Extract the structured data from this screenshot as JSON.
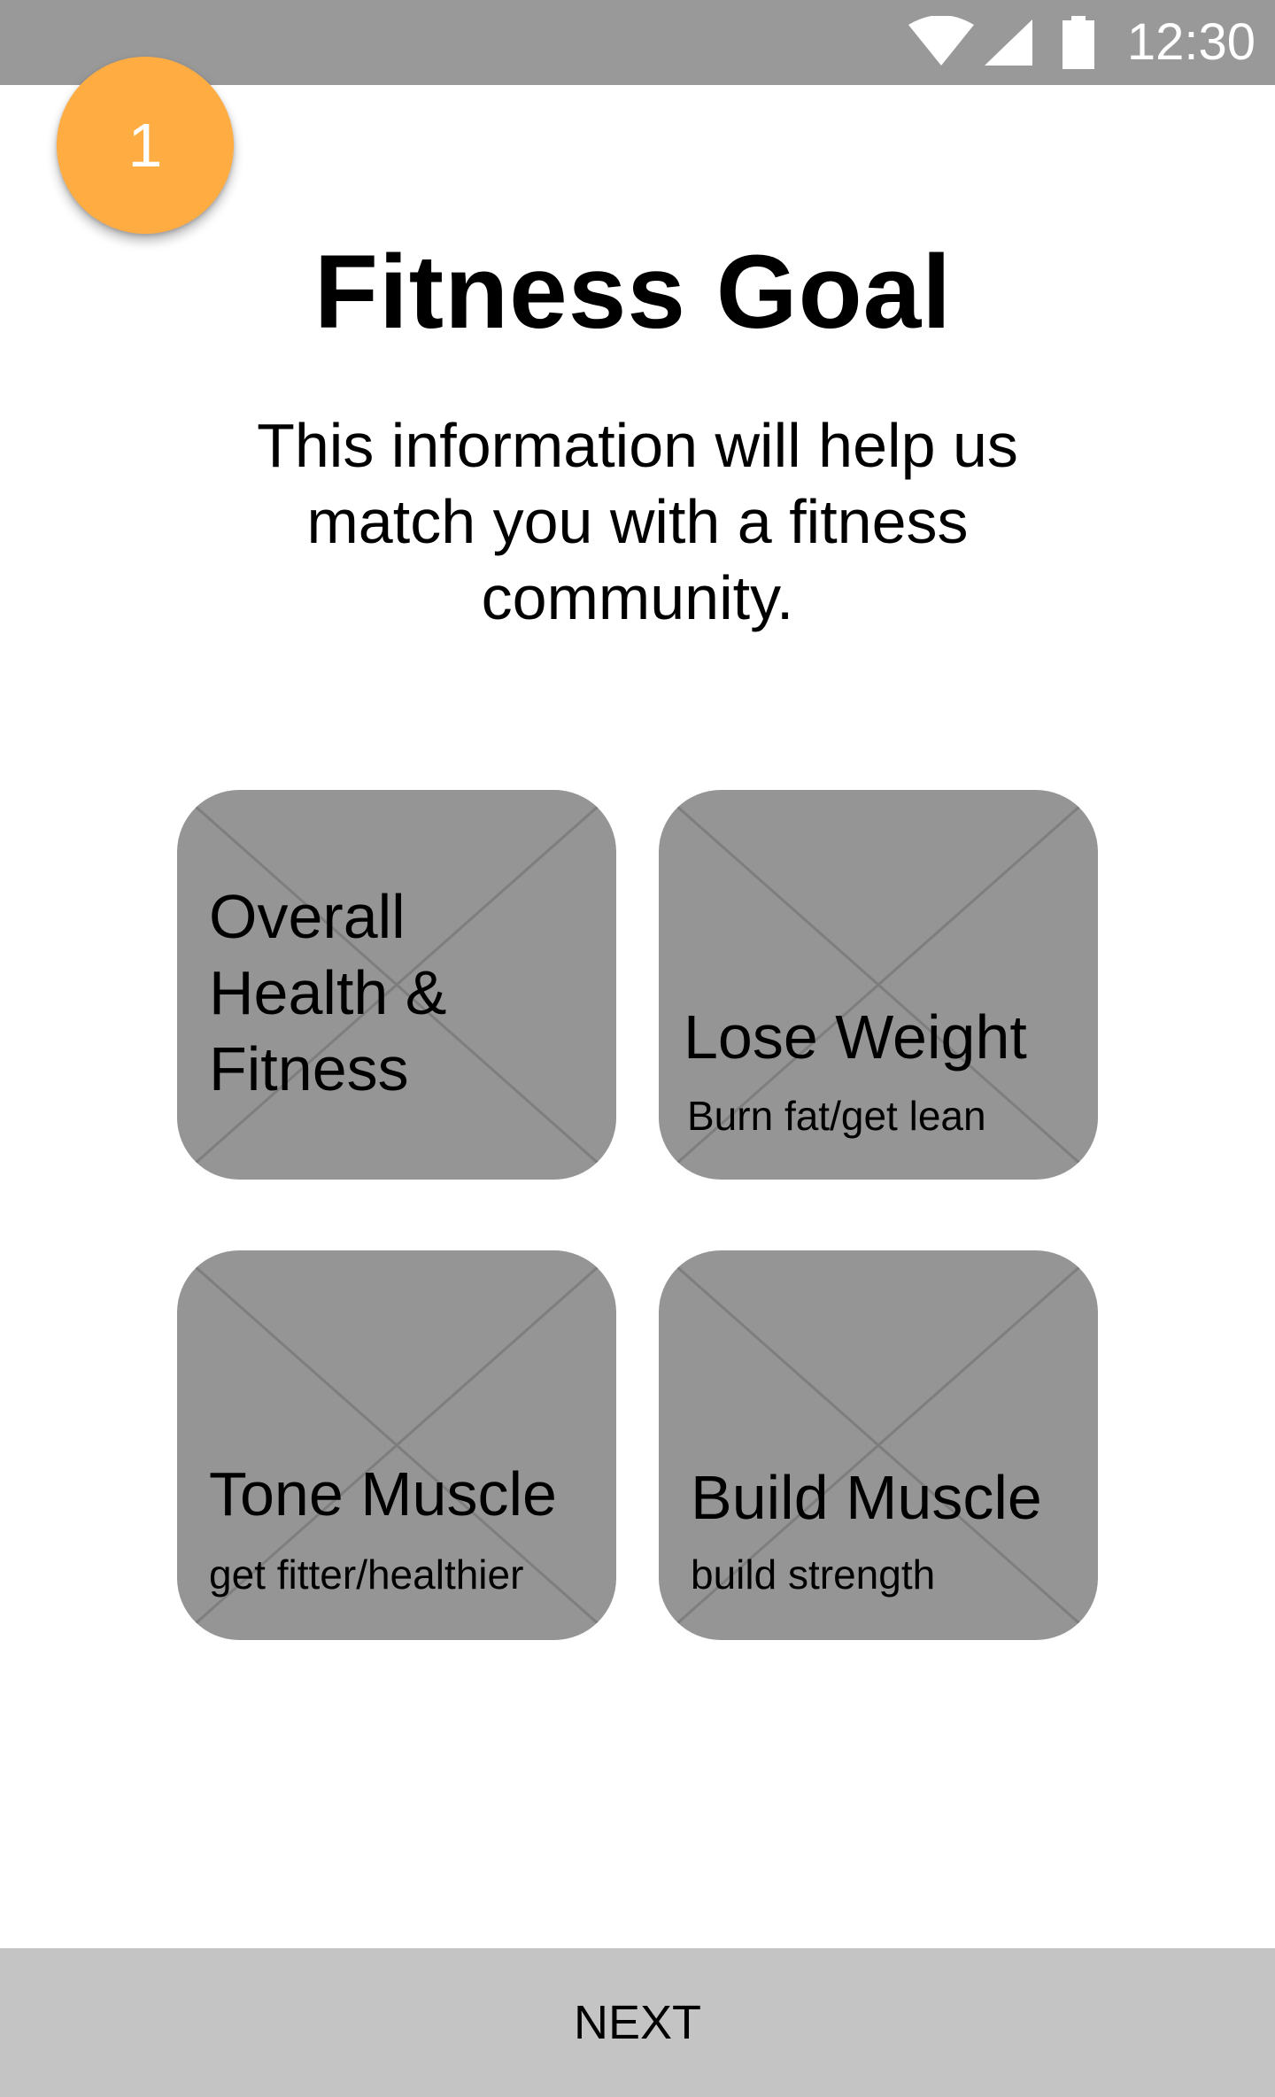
{
  "status_bar": {
    "time": "12:30",
    "icons": [
      "wifi-icon",
      "cellular-signal-icon",
      "battery-icon"
    ],
    "background": "#999999"
  },
  "step": {
    "number": "1",
    "color": "#ffad42"
  },
  "title": "Fitness Goal",
  "subtitle": "This information will help us match you with a fitness community.",
  "goals": [
    {
      "title": "Overall Health & Fitness",
      "subtitle": ""
    },
    {
      "title": "Lose Weight",
      "subtitle": "Burn fat/get lean"
    },
    {
      "title": "Tone Muscle",
      "subtitle": "get fitter/healthier"
    },
    {
      "title": "Build Muscle",
      "subtitle": "build strength"
    }
  ],
  "next_button": {
    "label": "NEXT"
  },
  "colors": {
    "card_background": "#959595",
    "next_bar_background": "#c4c4c4"
  }
}
